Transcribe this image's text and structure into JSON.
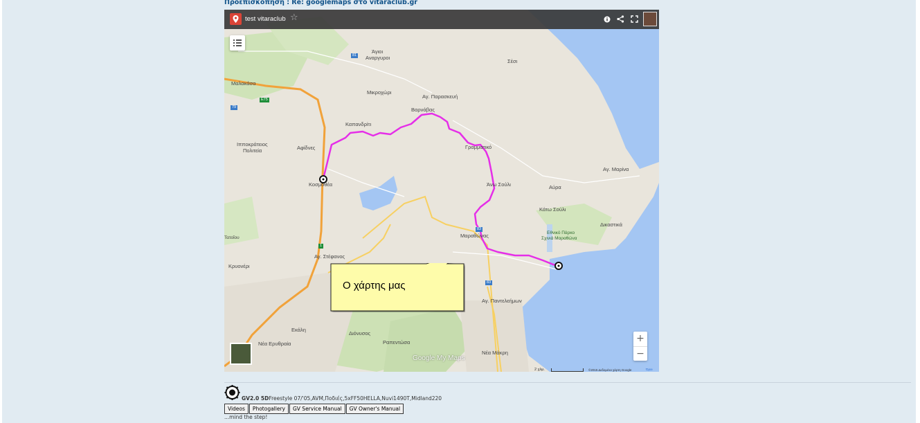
{
  "preview_title": "Προεπισκόπηση : Re: googlemaps στο vitaraclub.gr",
  "map": {
    "title": "test vitaraclub",
    "toolbar_icons": [
      "info-icon",
      "share-icon",
      "fullscreen-icon",
      "avatar"
    ],
    "labels": {
      "agioi": "Άγιοι",
      "anargyroi": "Αναργυροι",
      "malakasa": "Μαλακάσα",
      "sesi": "Σέσι",
      "mikrochori": "Μικροχώρι",
      "ag_paraskevi": "Αγ. Παρασκευή",
      "varnavas": "Βαρνάβας",
      "kapandriti": "Καπανδρίτι",
      "ippokrateios1": "Ιπποκράτειος",
      "ippokrateios2": "Πολιτεία",
      "afidnes": "Αφίδνες",
      "grammatiko": "Γραμματικό",
      "ag_marina": "Αγ. Μαρίνα",
      "kosmothea": "Κοσμοθέα",
      "ano_souli": "Άνω Σούλι",
      "avra": "Αύρα",
      "kato_souli": "Κάτω Σούλι",
      "park1": "Εθνικό Πάρκο",
      "park2": "Σχινιά Μαραθώνα",
      "dikastika": "Δικαστικά",
      "tatoiou": "Τατοΐου",
      "marathonas": "Μαραθώνας",
      "ag_stefanos": "Αγ. Στέφανος",
      "kryoneri": "Κρυονέρι",
      "ag_panteleimon": "Αγ. Παντελεήμων",
      "ekali": "Εκάλη",
      "dionysos": "Διόνυσος",
      "nea_erythraia": "Νέα Ερυθραία",
      "rapentosa": "Ραπεντώσα",
      "nea_makri": "Νέα Μάκρη",
      "road_81": "81",
      "road_e75": "E75",
      "road_79": "79",
      "road_1": "1",
      "road_83a": "83",
      "road_83b": "83"
    },
    "google_logo": "Google My Maps",
    "scale": "2 χλμ.",
    "copyright": "©2015 Δεδομένα χάρτη Google",
    "terms": "Όροι",
    "zoom_in": "+",
    "zoom_out": "−",
    "callout_text": "Ο χάρτης μας",
    "route_color": "#e52ee8"
  },
  "signature": {
    "model": "GV2.0 5D",
    "details": "Freestyle 07/'05,AVM,Ποδιές,5xFF50HELLA,Nuvi1490T,Midland220",
    "buttons": [
      "Videos",
      "Photogallery",
      "GV Service Manual",
      "GV Owner's Manual"
    ],
    "footer": "...mind the step!"
  }
}
